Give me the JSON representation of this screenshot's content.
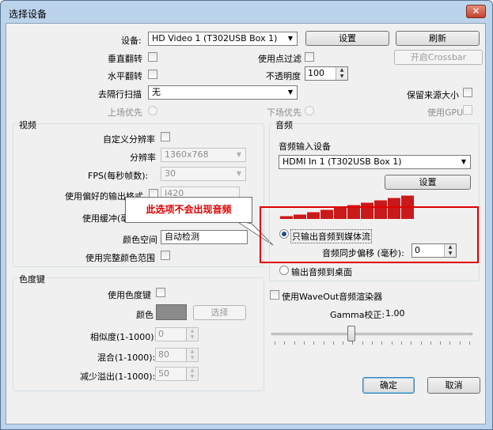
{
  "window": {
    "title": "选择设备",
    "close_glyph": "✕"
  },
  "device": {
    "label": "设备:",
    "value": "HD Video 1 (T302USB Box 1)",
    "settings_btn": "设置",
    "refresh_btn": "刷新",
    "flip_v": "垂直翻转",
    "flip_h": "水平翻转",
    "point_filter": "使用点过滤",
    "crossbar_btn": "开启Crossbar",
    "opacity_label": "不透明度",
    "opacity_value": "100",
    "deinterlace_label": "去隔行扫描",
    "deinterlace_value": "无",
    "keep_source_size": "保留来源大小",
    "top_field": "上场优先",
    "bottom_field": "下场优先",
    "use_gpu": "使用GPU"
  },
  "video": {
    "group": "视频",
    "custom_res": "自定义分辨率",
    "res_label": "分辨率",
    "res_value": "1360x768",
    "fps_label": "FPS(每秒帧数):",
    "fps_value": "30",
    "pref_format": "使用偏好的输出格式",
    "format_value": "I420",
    "buffer_label": "使用缓冲(毫",
    "colorspace_label": "颜色空间",
    "colorspace_value": "自动检测",
    "full_range": "使用完整颜色范围"
  },
  "callout": {
    "text": "此选项不会出现音频"
  },
  "audio": {
    "group": "音频",
    "input_label": "音频输入设备",
    "input_value": "HDMI In 1 (T302USB Box 1)",
    "settings_btn": "设置",
    "levels": [
      0.12,
      0.2,
      0.3,
      0.4,
      0.5,
      0.6,
      0.7,
      0.8,
      0.9,
      1.0
    ],
    "output_media": "只输出音频到媒体流",
    "sync_label": "音频同步偏移 (毫秒):",
    "sync_value": "0",
    "output_desktop": "输出音频到桌面",
    "waveout": "使用WaveOut音频渲染器",
    "gamma_label": "Gamma校正:",
    "gamma_value": "1.00",
    "gamma_position": 0.397
  },
  "chroma": {
    "group": "色度键",
    "use_chroma": "使用色度键",
    "color_label": "颜色",
    "select_btn": "选择",
    "similarity_label": "相似度(1-1000):",
    "similarity_value": "0",
    "blend_label": "混合(1-1000):",
    "blend_value": "80",
    "spill_label": "减少溢出(1-1000):",
    "spill_value": "50",
    "key_color": "#8b8b8b"
  },
  "dialog": {
    "ok_btn": "确定",
    "cancel_btn": "取消"
  },
  "colors": {
    "highlight": "#e00000",
    "meter": "#c81a1a"
  }
}
